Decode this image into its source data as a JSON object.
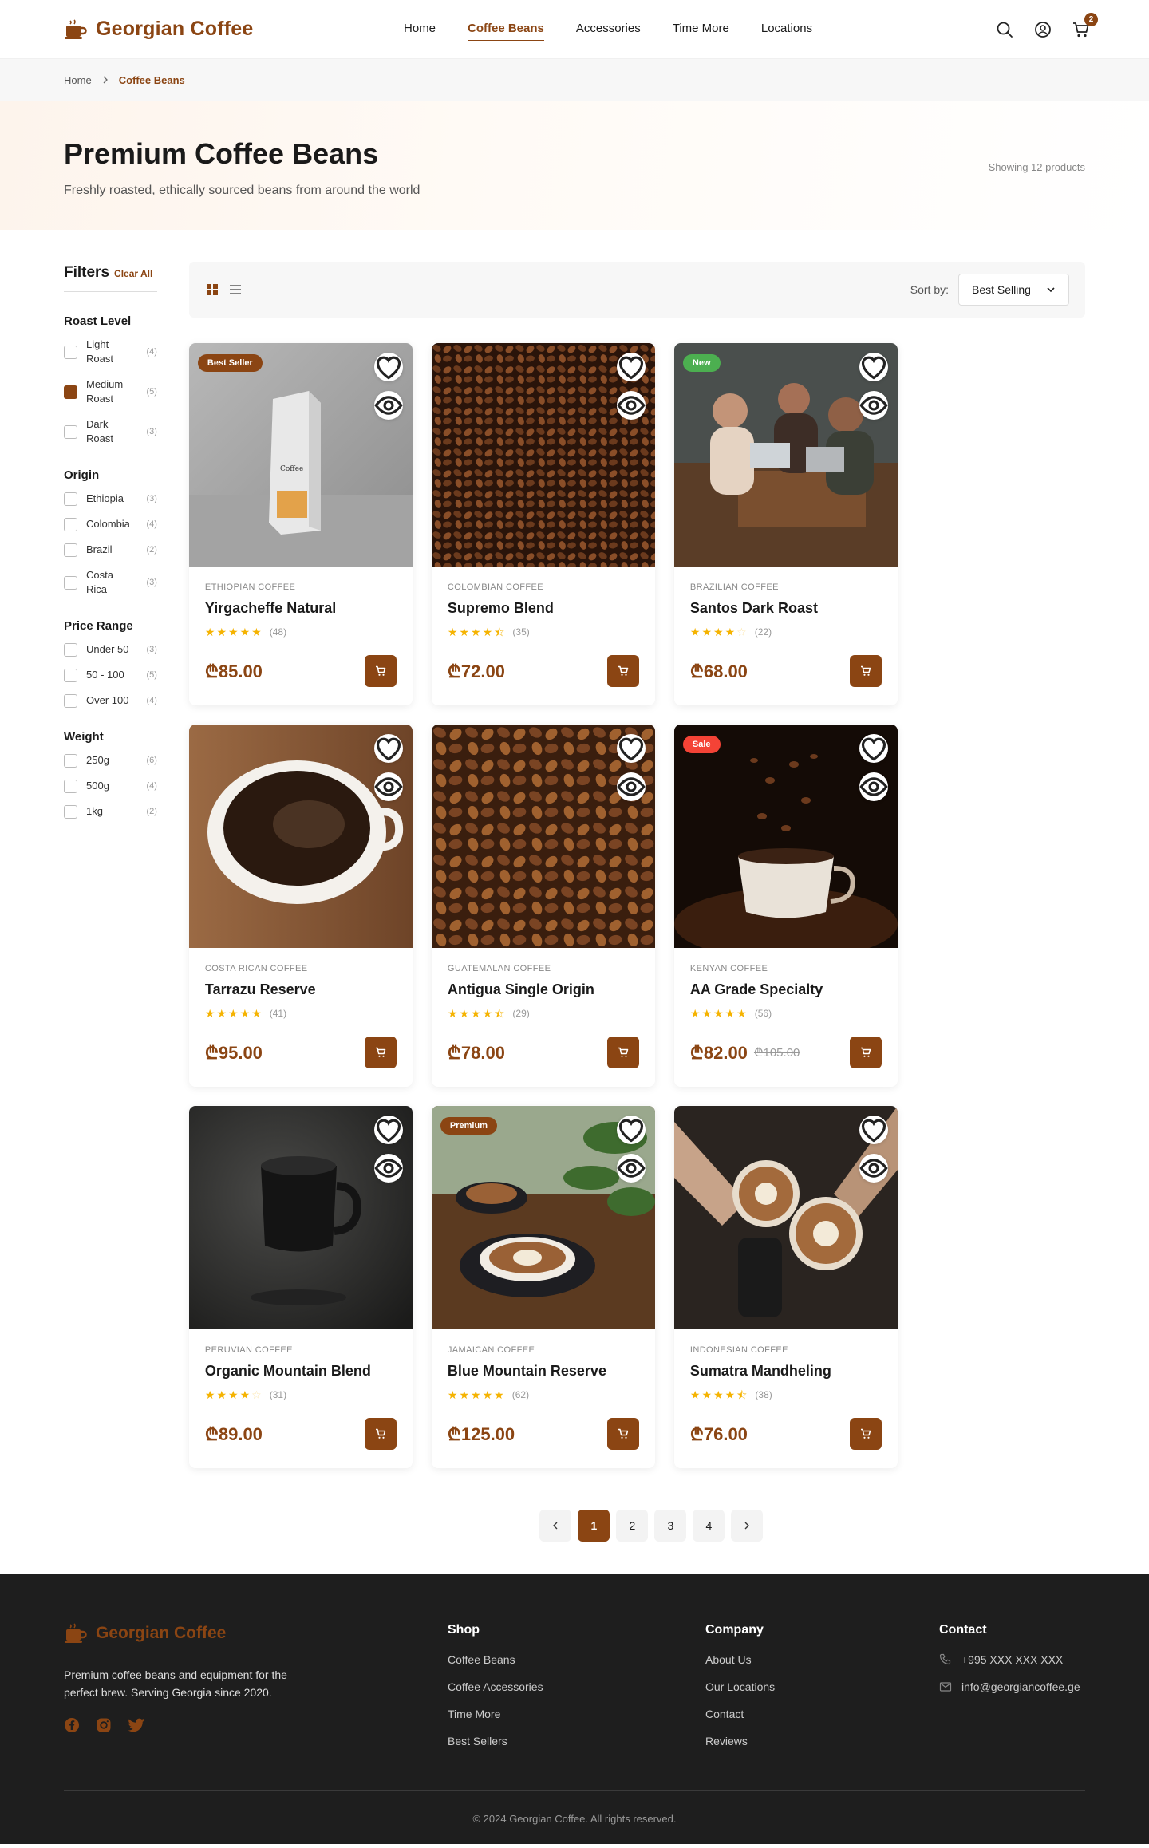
{
  "header": {
    "logo_text": "Georgian Coffee",
    "nav": [
      {
        "label": "Home"
      },
      {
        "label": "Coffee Beans"
      },
      {
        "label": "Accessories"
      },
      {
        "label": "Time More"
      },
      {
        "label": "Locations"
      }
    ],
    "active_nav": "Coffee Beans",
    "cart_count": "2"
  },
  "breadcrumb": {
    "home": "Home",
    "current": "Coffee Beans"
  },
  "hero": {
    "title": "Premium Coffee Beans",
    "subtitle": "Freshly roasted, ethically sourced beans from around the world",
    "count": "Showing 12 products"
  },
  "filters": {
    "title": "Filters",
    "clear": "Clear All",
    "groups": [
      {
        "title": "Roast Level",
        "options": [
          {
            "label": "Light Roast",
            "count": "(4)",
            "checked": false
          },
          {
            "label": "Medium Roast",
            "count": "(5)",
            "checked": true
          },
          {
            "label": "Dark Roast",
            "count": "(3)",
            "checked": false
          }
        ]
      },
      {
        "title": "Origin",
        "options": [
          {
            "label": "Ethiopia",
            "count": "(3)",
            "checked": false
          },
          {
            "label": "Colombia",
            "count": "(4)",
            "checked": false
          },
          {
            "label": "Brazil",
            "count": "(2)",
            "checked": false
          },
          {
            "label": "Costa Rica",
            "count": "(3)",
            "checked": false
          }
        ]
      },
      {
        "title": "Price Range",
        "options": [
          {
            "label": "Under 50",
            "count": "(3)",
            "checked": false
          },
          {
            "label": "50 - 100",
            "count": "(5)",
            "checked": false
          },
          {
            "label": "Over 100",
            "count": "(4)",
            "checked": false
          }
        ]
      },
      {
        "title": "Weight",
        "options": [
          {
            "label": "250g",
            "count": "(6)",
            "checked": false
          },
          {
            "label": "500g",
            "count": "(4)",
            "checked": false
          },
          {
            "label": "1kg",
            "count": "(2)",
            "checked": false
          }
        ]
      }
    ]
  },
  "toolbar": {
    "sort_label": "Sort by:",
    "sort_value": "Best Selling"
  },
  "colors": {
    "brand": "#8b4513",
    "badge_best_seller": "#8b4513",
    "badge_new": "#4caf50",
    "badge_sale": "#f44336",
    "badge_premium": "#8b4513",
    "star": "#f5b301"
  },
  "products": [
    {
      "origin": "Ethiopian Coffee",
      "name": "Yirgacheffe Natural",
      "rating": 5,
      "reviews": "(48)",
      "price": "₾85.00",
      "old_price": "",
      "badge": "Best Seller",
      "badge_color": "#8b4513",
      "image": "coffee-bag"
    },
    {
      "origin": "Colombian Coffee",
      "name": "Supremo Blend",
      "rating": 4.5,
      "reviews": "(35)",
      "price": "₾72.00",
      "old_price": "",
      "badge": "",
      "badge_color": "",
      "image": "coffee-beans"
    },
    {
      "origin": "Brazilian Coffee",
      "name": "Santos Dark Roast",
      "rating": 4,
      "reviews": "(22)",
      "price": "₾68.00",
      "old_price": "",
      "badge": "New",
      "badge_color": "#4caf50",
      "image": "cafe-friends"
    },
    {
      "origin": "Costa Rican Coffee",
      "name": "Tarrazu Reserve",
      "rating": 5,
      "reviews": "(41)",
      "price": "₾95.00",
      "old_price": "",
      "badge": "",
      "badge_color": "",
      "image": "coffee-cup-table"
    },
    {
      "origin": "Guatemalan Coffee",
      "name": "Antigua Single Origin",
      "rating": 4.5,
      "reviews": "(29)",
      "price": "₾78.00",
      "old_price": "",
      "badge": "",
      "badge_color": "",
      "image": "coffee-beans-closeup"
    },
    {
      "origin": "Kenyan Coffee",
      "name": "AA Grade Specialty",
      "rating": 5,
      "reviews": "(56)",
      "price": "₾82.00",
      "old_price": "₾105.00",
      "badge": "Sale",
      "badge_color": "#f44336",
      "image": "cup-falling-beans"
    },
    {
      "origin": "Peruvian Coffee",
      "name": "Organic Mountain Blend",
      "rating": 4,
      "reviews": "(31)",
      "price": "₾89.00",
      "old_price": "",
      "badge": "",
      "badge_color": "",
      "image": "black-mug"
    },
    {
      "origin": "Jamaican Coffee",
      "name": "Blue Mountain Reserve",
      "rating": 5,
      "reviews": "(62)",
      "price": "₾125.00",
      "old_price": "",
      "badge": "Premium",
      "badge_color": "#8b4513",
      "image": "latte-art-cups"
    },
    {
      "origin": "Indonesian Coffee",
      "name": "Sumatra Mandheling",
      "rating": 4.5,
      "reviews": "(38)",
      "price": "₾76.00",
      "old_price": "",
      "badge": "",
      "badge_color": "",
      "image": "latte-hands"
    }
  ],
  "pagination": {
    "pages": [
      "1",
      "2",
      "3",
      "4"
    ],
    "current": "1"
  },
  "footer": {
    "logo_text": "Georgian Coffee",
    "description": "Premium coffee beans and equipment for the perfect brew. Serving Georgia since 2020.",
    "shop_title": "Shop",
    "shop_links": [
      "Coffee Beans",
      "Coffee Accessories",
      "Time More",
      "Best Sellers"
    ],
    "company_title": "Company",
    "company_links": [
      "About Us",
      "Our Locations",
      "Contact",
      "Reviews"
    ],
    "contact_title": "Contact",
    "phone": "+995 XXX XXX XXX",
    "email": "info@georgiancoffee.ge",
    "copyright": "© 2024 Georgian Coffee. All rights reserved."
  }
}
